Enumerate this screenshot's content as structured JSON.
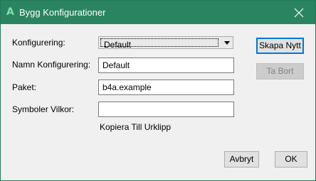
{
  "window": {
    "title": "Bygg Konfigurationer",
    "app_icon_glyph": "A"
  },
  "colors": {
    "titlebar": "#2b8461",
    "dialog_bg": "#f0f0f0",
    "accent_focus": "#0078d7"
  },
  "form": {
    "config_label": "Konfigurering:",
    "config_selected": "Default",
    "name_label": "Namn Konfigurering:",
    "name_value": "Default",
    "package_label": "Paket:",
    "package_value": "b4a.example",
    "symbols_label": "Symboler Vilkor:",
    "symbols_value": "",
    "copy_link": "Kopiera Till Urklipp"
  },
  "buttons": {
    "create_new": "Skapa Nytt",
    "remove": "Ta Bort",
    "cancel": "Avbryt",
    "ok": "OK"
  },
  "icons": {
    "app": "b4a-app-icon",
    "close": "close-icon",
    "dropdown": "chevron-down-icon"
  }
}
